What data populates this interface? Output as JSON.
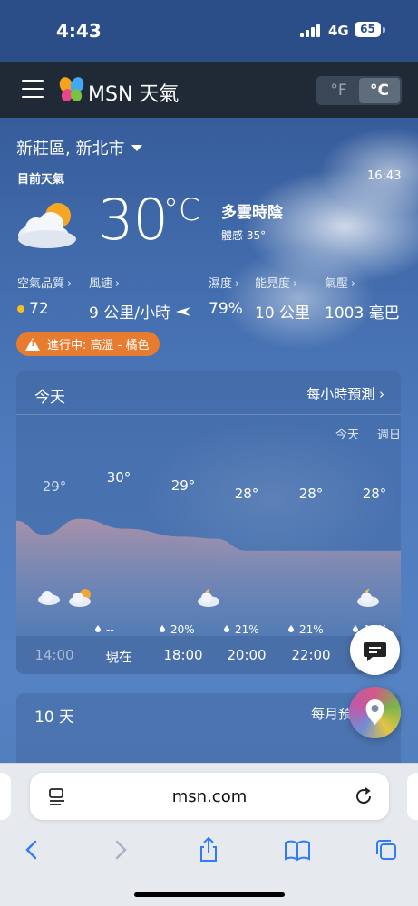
{
  "status_bar": {
    "time": "4:43",
    "network": "4G",
    "battery": "65"
  },
  "header": {
    "brand": "MSN 天氣",
    "units": [
      "°F",
      "°C"
    ],
    "active_unit": "°C"
  },
  "location": {
    "name": "新莊區, 新北市"
  },
  "current": {
    "label": "目前天氣",
    "time": "16:43",
    "temp": "30",
    "unit": "°C",
    "condition": "多雲時陰",
    "feels_like": "體感 35°",
    "icon": "partly-cloudy-icon"
  },
  "metrics": [
    {
      "label": "空氣品質",
      "value": "72"
    },
    {
      "label": "風速",
      "value": "9 公里/小時"
    },
    {
      "label": "濕度",
      "value": "79%"
    },
    {
      "label": "能見度",
      "value": "10 公里"
    },
    {
      "label": "氣壓",
      "value": "1003 毫巴"
    }
  ],
  "alert": {
    "text": "進行中: 高溫 - 橘色",
    "color": "#e77b2f"
  },
  "today": {
    "title": "今天",
    "link": "每小時預測",
    "switch": [
      "今天",
      "週日"
    ],
    "hours": [
      "14:00",
      "現在",
      "18:00",
      "20:00",
      "22:00"
    ],
    "temps": [
      "29°",
      "30°",
      "29°",
      "28°",
      "28°",
      "28°"
    ],
    "precip": [
      "--",
      "20%",
      "21%",
      "21%",
      "17%"
    ]
  },
  "ten_day": {
    "title": "10 天",
    "link": "每月預"
  },
  "browser": {
    "url": "msn.com"
  },
  "chart_data": {
    "type": "area",
    "x": [
      "14:00",
      "現在",
      "18:00",
      "20:00",
      "22:00",
      ""
    ],
    "series": [
      {
        "values": [
          29,
          30,
          29,
          28,
          28,
          28
        ]
      }
    ]
  }
}
